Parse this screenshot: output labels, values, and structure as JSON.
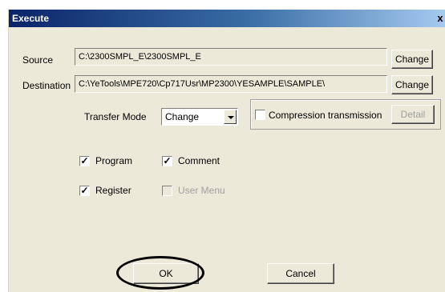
{
  "window": {
    "title": "Execute",
    "close_glyph": "x"
  },
  "source": {
    "label": "Source",
    "value": "C:\\2300SMPL_E\\2300SMPL_E",
    "change_label": "Change"
  },
  "destination": {
    "label": "Destination",
    "value": "C:\\YeTools\\MPE720\\Cp717Usr\\MP2300\\YESAMPLE\\SAMPLE\\",
    "change_label": "Change"
  },
  "transfer_mode": {
    "label": "Transfer Mode",
    "selected": "Change"
  },
  "compression": {
    "label": "Compression transmission",
    "checked": false,
    "detail_label": "Detail"
  },
  "checkboxes": {
    "program": {
      "label": "Program",
      "checked": "✓"
    },
    "comment": {
      "label": "Comment",
      "checked": "✓"
    },
    "register": {
      "label": "Register",
      "checked": "✓"
    },
    "user_menu": {
      "label": "User Menu",
      "checked": "✓"
    }
  },
  "buttons": {
    "ok": "OK",
    "cancel": "Cancel"
  }
}
